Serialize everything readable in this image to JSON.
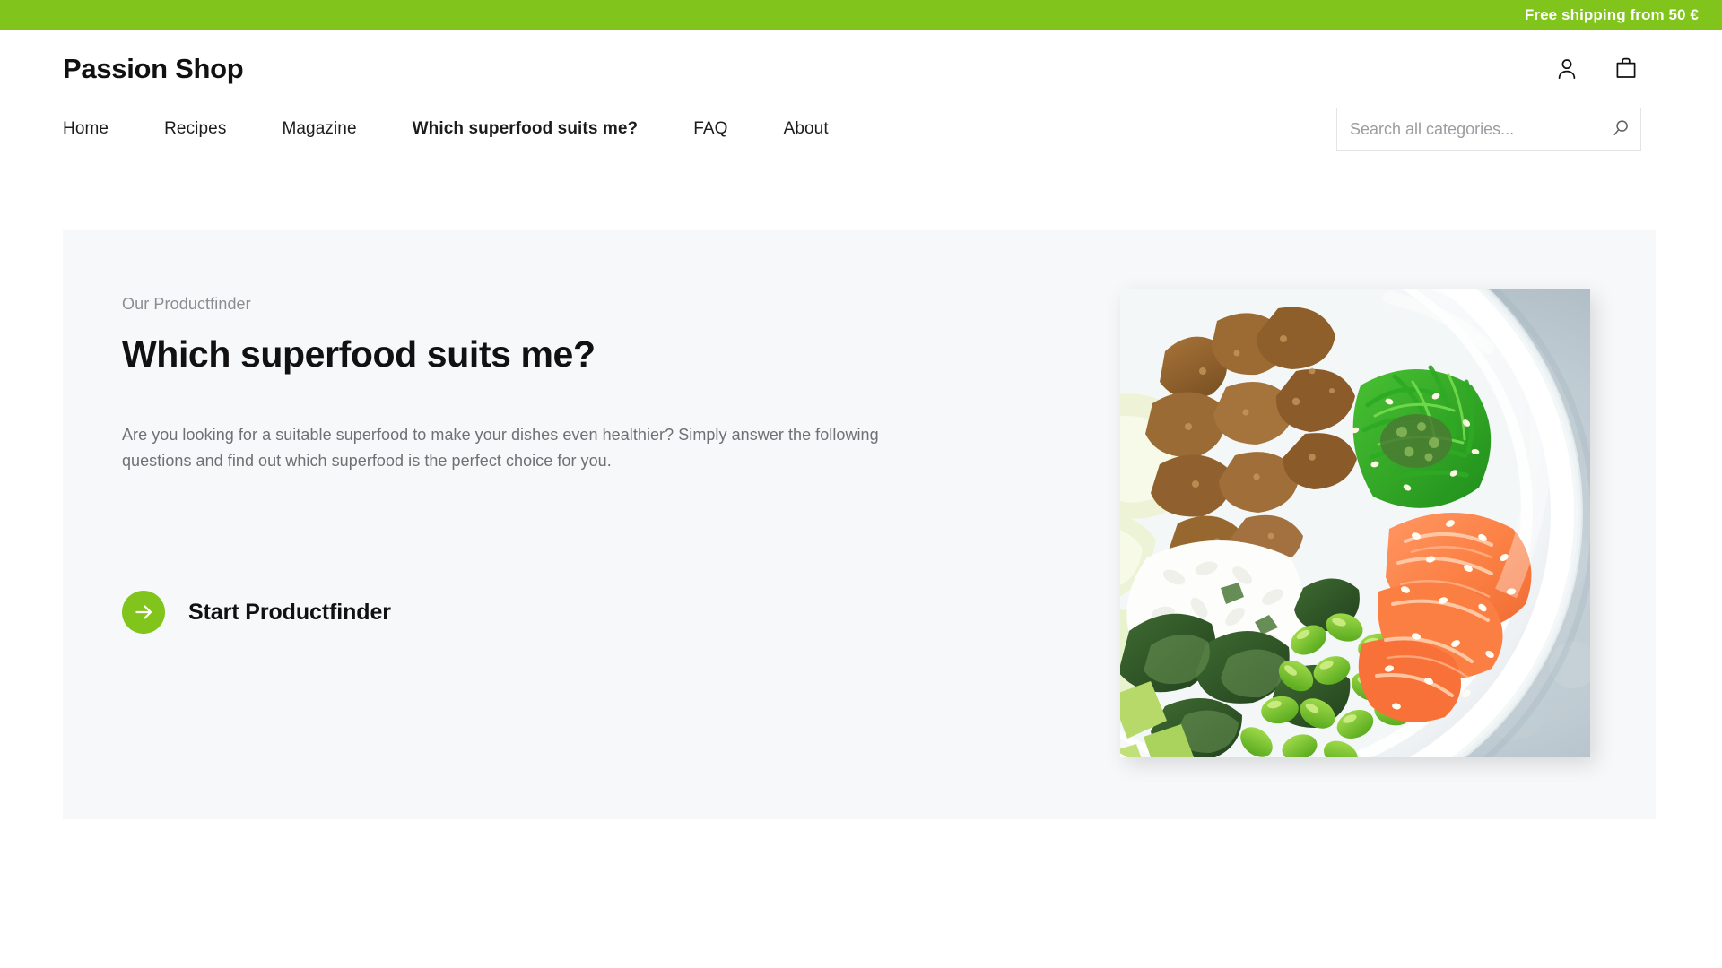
{
  "announcement": {
    "text": "Free shipping from 50 €",
    "bg_color": "#80C41C",
    "text_color": "#ffffff"
  },
  "header": {
    "brand": "Passion Shop",
    "account_icon": "user-icon",
    "cart_icon": "shopping-bag-icon",
    "nav": [
      {
        "label": "Home",
        "active": false
      },
      {
        "label": "Recipes",
        "active": false
      },
      {
        "label": "Magazine",
        "active": false
      },
      {
        "label": "Which superfood suits me?",
        "active": true
      },
      {
        "label": "FAQ",
        "active": false
      },
      {
        "label": "About",
        "active": false
      }
    ],
    "search": {
      "placeholder": "Search all categories...",
      "value": "",
      "icon": "search-icon"
    }
  },
  "hero": {
    "eyebrow": "Our Productfinder",
    "title": "Which superfood suits me?",
    "description": "Are you looking for a suitable superfood to make your dishes even healthier? Simply answer the following questions and find out which superfood is the perfect choice for you.",
    "cta_label": "Start Productfinder",
    "cta_icon": "arrow-right-icon",
    "cta_color": "#80C41C",
    "background_color": "#f7f8fa",
    "image_alt": "poke-bowl-with-salmon-edamame-seaweed-and-rice"
  }
}
